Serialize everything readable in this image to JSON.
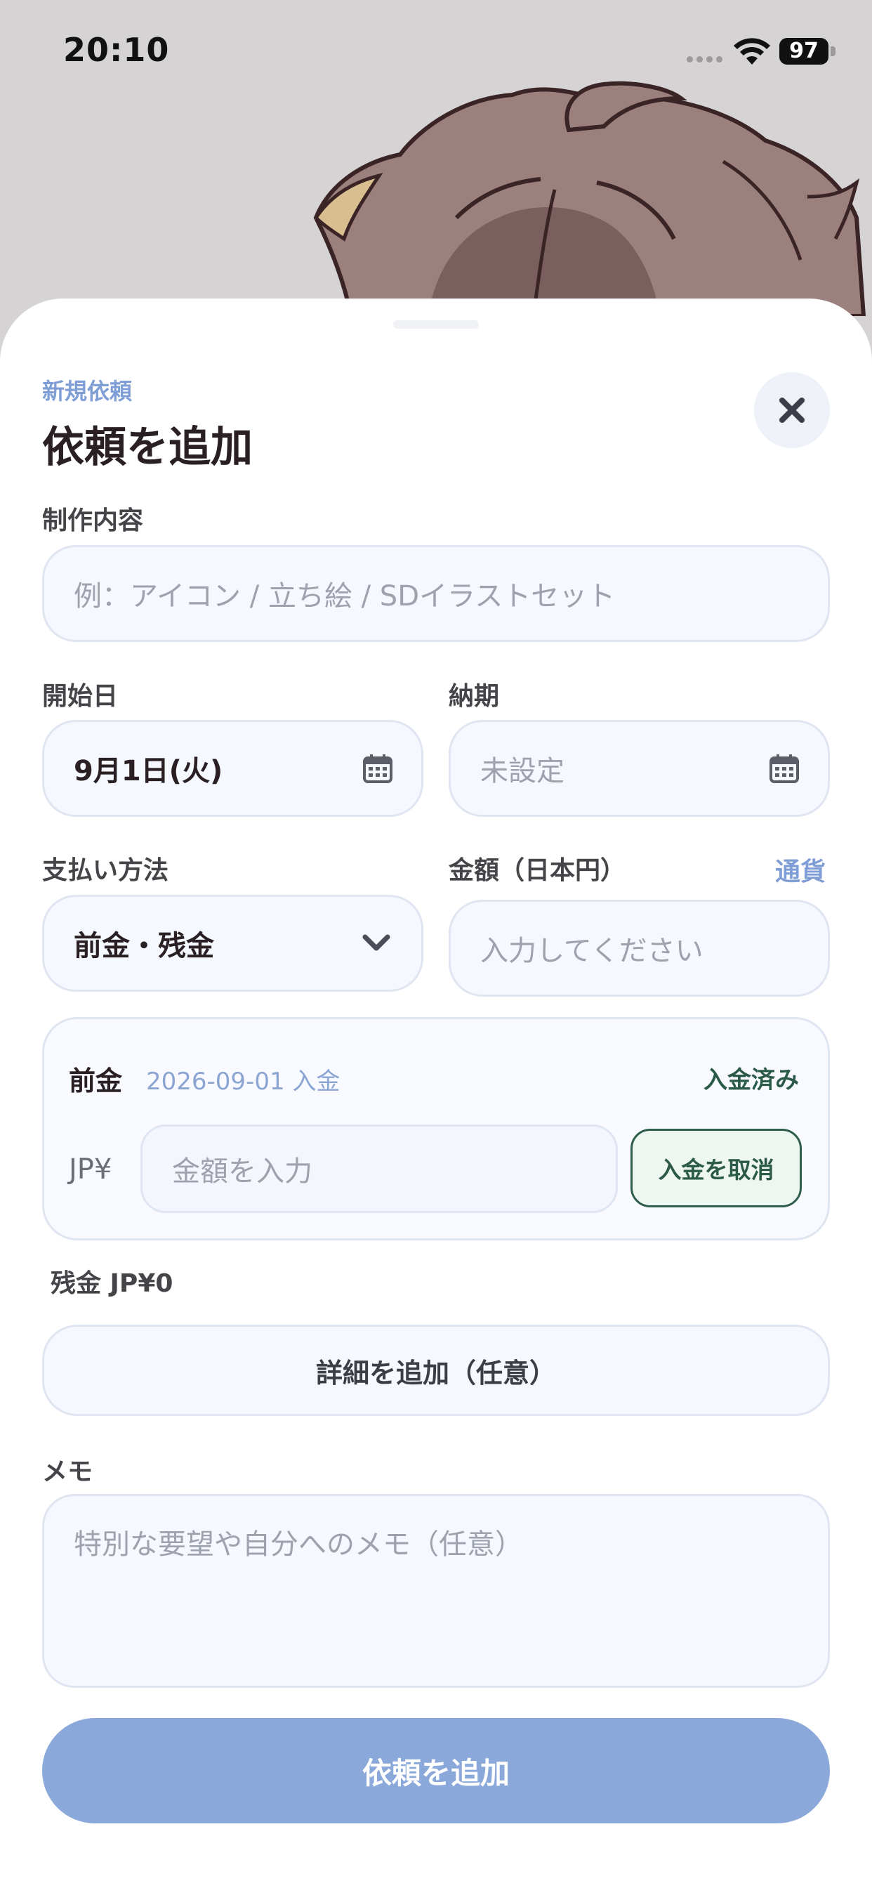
{
  "status_bar": {
    "time": "20:10",
    "battery": "97"
  },
  "header": {
    "subtitle": "新規依頼",
    "title": "依頼を追加"
  },
  "form": {
    "content": {
      "label": "制作内容",
      "placeholder": "例：アイコン / 立ち絵 / SDイラストセット"
    },
    "start_date": {
      "label": "開始日",
      "value": "9月1日(火)"
    },
    "deadline": {
      "label": "納期",
      "placeholder": "未設定"
    },
    "payment_method": {
      "label": "支払い方法",
      "value": "前金・残金"
    },
    "amount": {
      "label": "金額（日本円）",
      "currency_link": "通貨",
      "placeholder": "入力してください"
    },
    "deposit": {
      "label": "前金",
      "date": "2026-09-01 入金",
      "status": "入金済み",
      "currency": "JP¥",
      "placeholder": "金額を入力",
      "cancel_label": "入金を取消"
    },
    "balance": "残金 JP¥0",
    "details_button": "詳細を追加（任意）",
    "memo": {
      "label": "メモ",
      "placeholder": "特別な要望や自分へのメモ（任意）"
    },
    "submit": "依頼を追加"
  },
  "icons": [
    "close-icon",
    "calendar-icon",
    "chevron-down-icon",
    "wifi-icon",
    "battery-icon"
  ],
  "colors": {
    "accent": "#8aa8da",
    "link": "#7f9ed6",
    "success": "#2c5a48",
    "field_bg": "#f5f8fe"
  }
}
